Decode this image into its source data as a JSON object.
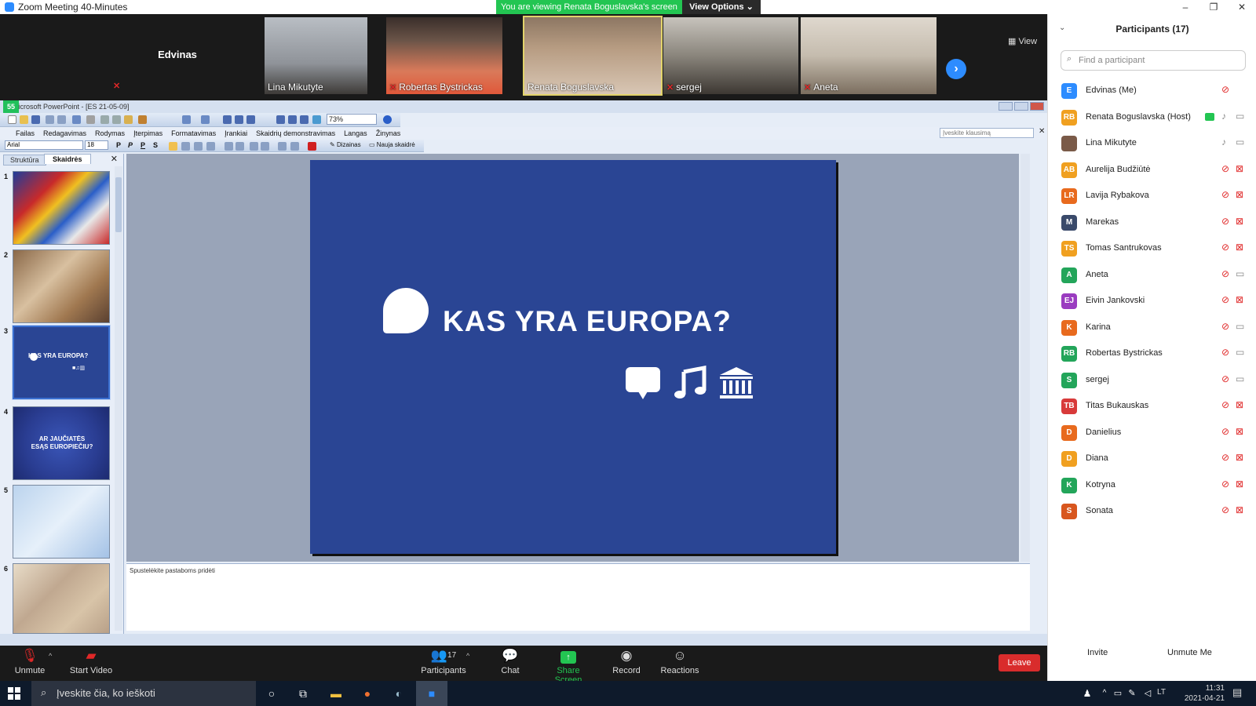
{
  "window": {
    "title": "Zoom Meeting 40-Minutes",
    "controls": [
      "–",
      "❐",
      "✕"
    ]
  },
  "share_banner": "You are viewing Renata Boguslavska's screen",
  "view_options": "View Options ⌄",
  "video_strip": {
    "self_name": "Edvinas",
    "tiles": [
      {
        "name": "Lina Mikutyte",
        "muted": false
      },
      {
        "name": "Robertas Bystrickas",
        "muted": true
      },
      {
        "name": "Renata Boguslavska",
        "muted": false
      },
      {
        "name": "sergej",
        "muted": true
      },
      {
        "name": "Aneta",
        "muted": true
      }
    ],
    "view_label": "View"
  },
  "ppt": {
    "title": "Microsoft PowerPoint - [ES 21-05-09]",
    "badge": "55",
    "zoom": "73%",
    "menu": [
      "Failas",
      "Redagavimas",
      "Rodymas",
      "Įterpimas",
      "Formatavimas",
      "Įrankiai",
      "Skaidrių demonstravimas",
      "Langas",
      "Žinynas"
    ],
    "help_placeholder": "Įveskite klausimą",
    "font": "Arial",
    "font_size": "18",
    "format_buttons": [
      "P",
      "P",
      "P",
      "S"
    ],
    "design_label": "Dizainas",
    "new_slide_label": "Nauja skaidrė",
    "tabs": {
      "structure": "Struktūra",
      "slides": "Skaidrės"
    },
    "thumbnails": {
      "numbers": [
        "1",
        "2",
        "3",
        "4",
        "5",
        "6"
      ],
      "thumb3_title": "KAS YRA EUROPA?",
      "thumb4_title": "AR JAUČIATĖS ESĄS EUROPIEČIU?"
    },
    "slide": {
      "title": "KAS YRA EUROPA?",
      "background": "#2a4594"
    },
    "notes_placeholder": "Spustelėkite pastaboms pridėti"
  },
  "toolbar": {
    "unmute": "Unmute",
    "start_video": "Start Video",
    "participants": "Participants",
    "participants_count": "17",
    "chat": "Chat",
    "share_screen": "Share Screen",
    "record": "Record",
    "reactions": "Reactions",
    "leave": "Leave"
  },
  "participants_panel": {
    "title": "Participants (17)",
    "search_placeholder": "Find a participant",
    "invite": "Invite",
    "unmute_me": "Unmute Me",
    "people": [
      {
        "initials": "E",
        "name": "Edvinas (Me)",
        "color": "#2d8cff",
        "mic": "muted",
        "cam": "none"
      },
      {
        "initials": "RB",
        "name": "Renata Boguslavska (Host)",
        "color": "#f0a020",
        "mic": "on",
        "cam": "on",
        "sharing": true
      },
      {
        "initials": "",
        "name": "Lina Mikutyte",
        "color": "#7a5a48",
        "mic": "on",
        "cam": "on"
      },
      {
        "initials": "AB",
        "name": "Aurelija Budžiūtė",
        "color": "#f0a020",
        "mic": "muted",
        "cam": "off"
      },
      {
        "initials": "LR",
        "name": "Lavija Rybakova",
        "color": "#e86a1e",
        "mic": "muted",
        "cam": "off"
      },
      {
        "initials": "M",
        "name": "Marekas",
        "color": "#3a4a6a",
        "mic": "muted",
        "cam": "off"
      },
      {
        "initials": "TS",
        "name": "Tomas Santrukovas",
        "color": "#f0a020",
        "mic": "muted",
        "cam": "off"
      },
      {
        "initials": "A",
        "name": "Aneta",
        "color": "#23a55a",
        "mic": "muted",
        "cam": "on"
      },
      {
        "initials": "EJ",
        "name": "Eivin Jankovski",
        "color": "#9a3cc0",
        "mic": "muted",
        "cam": "off"
      },
      {
        "initials": "K",
        "name": "Karina",
        "color": "#e86a1e",
        "mic": "muted",
        "cam": "on"
      },
      {
        "initials": "RB",
        "name": "Robertas Bystrickas",
        "color": "#23a55a",
        "mic": "muted",
        "cam": "on"
      },
      {
        "initials": "S",
        "name": "sergej",
        "color": "#23a55a",
        "mic": "muted",
        "cam": "on"
      },
      {
        "initials": "TB",
        "name": "Titas Bukauskas",
        "color": "#d83a3a",
        "mic": "muted",
        "cam": "off"
      },
      {
        "initials": "D",
        "name": "Danielius",
        "color": "#e86a1e",
        "mic": "muted",
        "cam": "off"
      },
      {
        "initials": "D",
        "name": "Diana",
        "color": "#f0a020",
        "mic": "muted",
        "cam": "off"
      },
      {
        "initials": "K",
        "name": "Kotryna",
        "color": "#23a55a",
        "mic": "muted",
        "cam": "off"
      },
      {
        "initials": "S",
        "name": "Sonata",
        "color": "#d8561e",
        "mic": "muted",
        "cam": "off"
      }
    ]
  },
  "taskbar": {
    "search_placeholder": "Įveskite čia, ko ieškoti",
    "lang": "LT",
    "time": "11:31",
    "date": "2021-04-21"
  }
}
